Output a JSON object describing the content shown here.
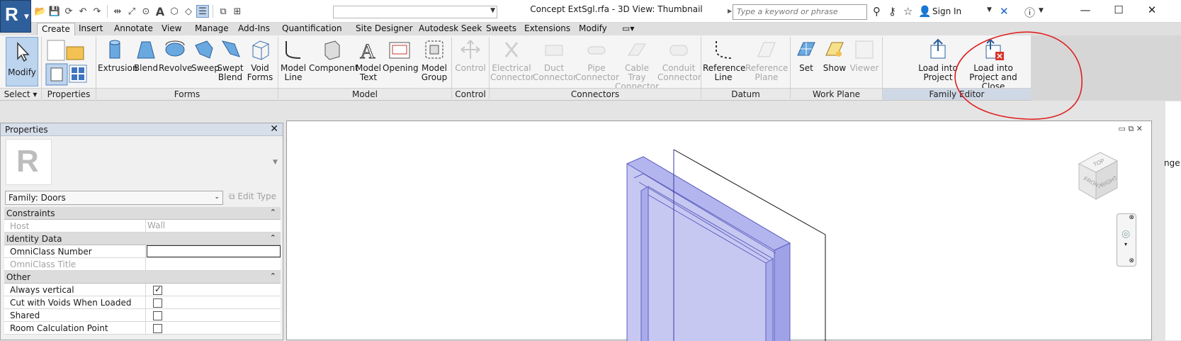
{
  "titlebar": {
    "doc_title": "Concept ExtSgl.rfa - 3D View: Thumbnail",
    "search_placeholder": "Type a keyword or phrase",
    "sign_in": "Sign In",
    "app_letter": "R"
  },
  "tabs": [
    "Create",
    "Insert",
    "Annotate",
    "View",
    "Manage",
    "Add-Ins",
    "Quantification",
    "Site Designer",
    "Autodesk Seek",
    "Sweets",
    "Extensions",
    "Modify"
  ],
  "ribbon": {
    "select": {
      "label": "Modify",
      "panel": "Select"
    },
    "properties_panel": "Properties",
    "forms": {
      "panel": "Forms",
      "buttons": [
        "Extrusion",
        "Blend",
        "Revolve",
        "Sweep",
        "Swept\nBlend",
        "Void\nForms"
      ]
    },
    "model": {
      "panel": "Model",
      "buttons": [
        "Model\nLine",
        "Component",
        "Model\nText",
        "Opening",
        "Model\nGroup"
      ]
    },
    "control": {
      "panel": "Control",
      "buttons": [
        "Control"
      ]
    },
    "connectors": {
      "panel": "Connectors",
      "buttons": [
        "Electrical\nConnector",
        "Duct\nConnector",
        "Pipe\nConnector",
        "Cable Tray\nConnector",
        "Conduit\nConnector"
      ]
    },
    "datum": {
      "panel": "Datum",
      "buttons": [
        "Reference\nLine",
        "Reference\nPlane"
      ]
    },
    "work_plane": {
      "panel": "Work Plane",
      "buttons": [
        "Set",
        "Show",
        "Viewer"
      ]
    },
    "family_editor": {
      "panel": "Family Editor",
      "buttons": [
        "Load into\nProject",
        "Load into\nProject and Close"
      ]
    }
  },
  "properties": {
    "title": "Properties",
    "type_letter": "R",
    "family_selector": "Family: Doors",
    "edit_type": "Edit Type",
    "groups": [
      {
        "name": "Constraints",
        "rows": [
          {
            "key": "Host",
            "value": "Wall",
            "disabled": true
          }
        ]
      },
      {
        "name": "Identity Data",
        "rows": [
          {
            "key": "OmniClass Number",
            "value": "",
            "editing": true
          },
          {
            "key": "OmniClass Title",
            "value": "",
            "disabled": true
          }
        ]
      },
      {
        "name": "Other",
        "rows": [
          {
            "key": "Always vertical",
            "checkbox": true,
            "checked": true
          },
          {
            "key": "Cut with Voids When Loaded",
            "checkbox": true,
            "checked": false
          },
          {
            "key": "Shared",
            "checkbox": true,
            "checked": false
          },
          {
            "key": "Room Calculation Point",
            "checkbox": true,
            "checked": false
          }
        ]
      }
    ]
  },
  "view": {
    "cube_top": "TOP",
    "cube_front": "FRONT",
    "cube_right": "RIGHT",
    "edge_text": "nge"
  },
  "colors": {
    "app_blue": "#2f5f9a",
    "door_fill": "#c7c8f2",
    "door_stroke": "#5d5fc0",
    "annotation_red": "#e02020"
  }
}
